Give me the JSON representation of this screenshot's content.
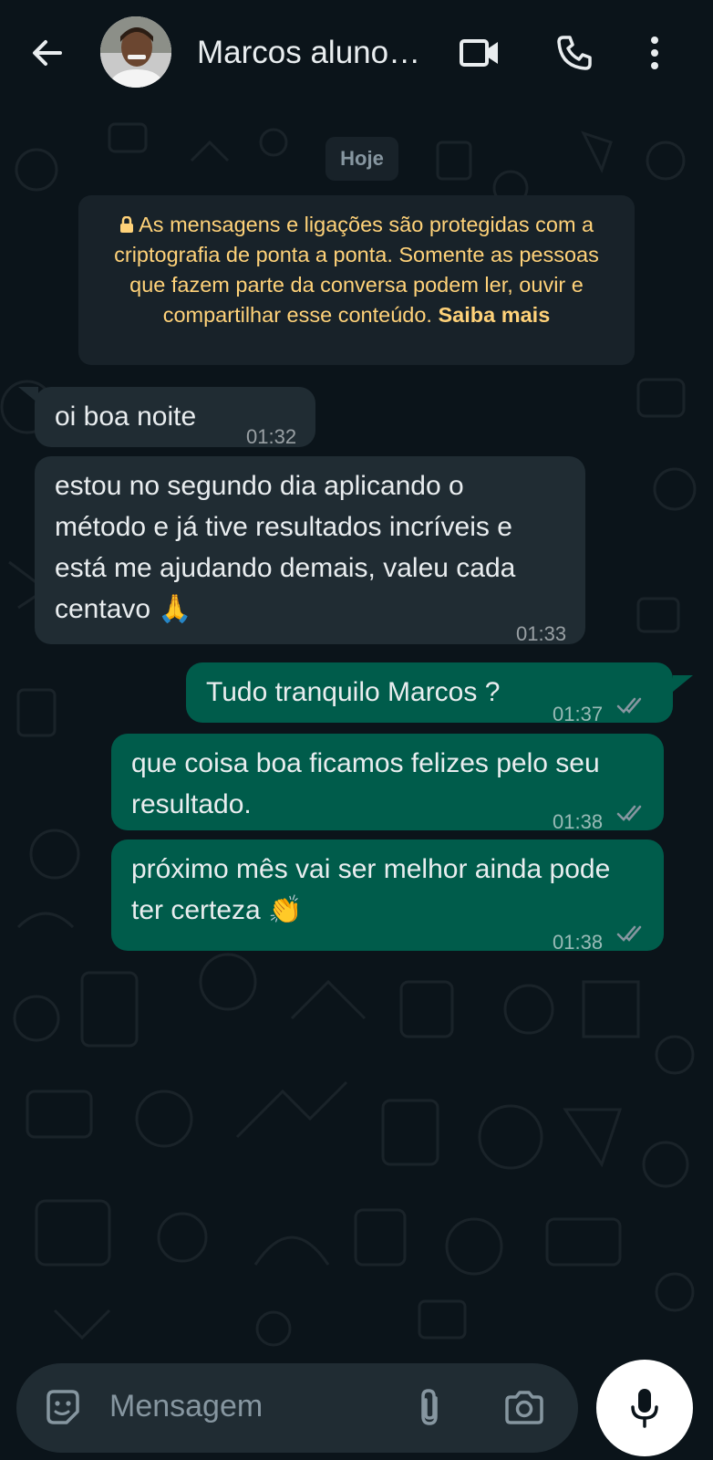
{
  "header": {
    "contact_name": "Marcos aluno…",
    "icons": [
      "back-arrow-icon",
      "avatar",
      "video-call-icon",
      "voice-call-icon",
      "more-options-icon"
    ]
  },
  "chat": {
    "date_label": "Hoje",
    "encryption_notice": {
      "text": "As mensagens e ligações são protegidas com a criptografia de ponta a ponta. Somente as pessoas que fazem parte da conversa podem ler, ouvir e compartilhar esse conteúdo.",
      "link": "Saiba mais",
      "icon": "lock-icon"
    },
    "messages": [
      {
        "direction": "in",
        "text": "oi boa noite",
        "time": "01:32"
      },
      {
        "direction": "in",
        "text": "estou no segundo dia aplicando o método e já tive resultados incríveis e está me ajudando demais, valeu cada centavo 🙏",
        "time": "01:33"
      },
      {
        "direction": "out",
        "text": "Tudo tranquilo Marcos ?",
        "time": "01:37",
        "status": "read-double-check"
      },
      {
        "direction": "out",
        "text": "que coisa boa ficamos felizes pelo seu resultado.",
        "time": "01:38",
        "status": "read-double-check"
      },
      {
        "direction": "out",
        "text": "próximo mês vai ser melhor ainda pode ter certeza 👏",
        "time": "01:38",
        "status": "read-double-check"
      }
    ]
  },
  "composer": {
    "placeholder": "Mensagem",
    "icons": [
      "sticker-icon",
      "attach-icon",
      "camera-icon",
      "mic-icon"
    ]
  },
  "colors": {
    "background": "#0b141a",
    "incoming_bubble": "#202c33",
    "outgoing_bubble": "#005c4b",
    "notice_text": "#ffd279",
    "ticks": "#8696a0"
  }
}
